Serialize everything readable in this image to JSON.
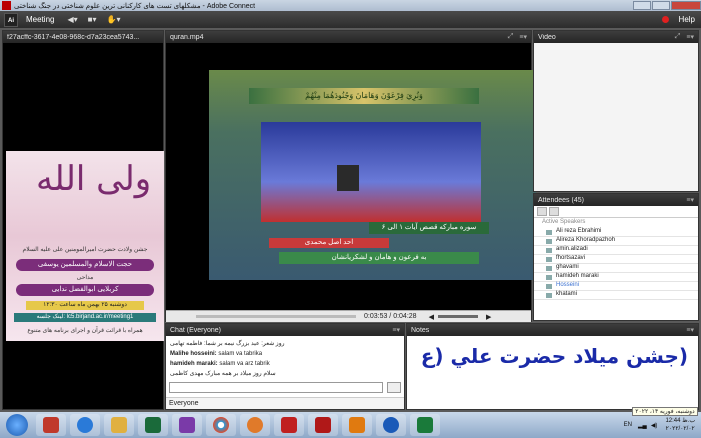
{
  "window": {
    "title": "مشکلهای تست های کارکنانی ترین علوم شناختی در جنگ شناختی - Adobe Connect"
  },
  "menubar": {
    "meeting": "Meeting",
    "help": "Help"
  },
  "pods": {
    "share_title": "f27acffc-3617-4e08-968c-d7a23cea5743...",
    "video_title": "quran.mp4",
    "camera_title": "Video",
    "attendees_title": "Attendees",
    "attendees_count": "(45)",
    "chat_title": "Chat",
    "chat_scope": "(Everyone)",
    "notes_title": "Notes"
  },
  "poster": {
    "big": "ولی الله",
    "line1": "جشن ولادت حضرت امیرالمومنین علی علیه السلام",
    "band1": "حجت الاسلام والمسلمین یوسفی",
    "line2": "مداحی",
    "band2": "کربلایی ابوالفضل ندایی",
    "yellow": "دوشنبه ۲۵ بهمن ماه ساعت ۱۲:۳۰",
    "teal": "لینک جلسه: lc5.birjand.ac.ir/meeting1",
    "foot": "همراه با قرائت قرآن و اجرای برنامه های متنوع"
  },
  "video": {
    "top_caption": "وَنُرِيَ فِرْعَوْنَ وَهَامَانَ وَجُنُودَهُمَا مِنْهُمْ",
    "cap1": "سوره مبارکه قصص آیات ۱ الی ۶",
    "cap2": "احد اصل محمدی",
    "cap3": "به فرعون و هامان و لشکریانشان",
    "time_current": "0:03:53",
    "time_total": "0:04:28"
  },
  "chat": {
    "messages": [
      {
        "user": "",
        "text": "روز شعر: عید بزرگ نیمه بر شما: فاطمه تهامی"
      },
      {
        "user": "Malihe hosseini:",
        "text": "salam va tabrika"
      },
      {
        "user": "hamideh maraki:",
        "text": "salam va arz tabrik"
      },
      {
        "user": "",
        "text": "سلام روز میلاد بر همه مبارک مهدی کاظمی"
      }
    ],
    "footer": "Everyone"
  },
  "notes": {
    "text": "(جشن میلاد حضرت علي (ع"
  },
  "attendees": {
    "group": "Active Speakers",
    "list": [
      "Ali reza Ebrahimi",
      "Alireza Khoradpazhoh",
      "amin.alizadi",
      "fhortsazavi",
      "ghavami",
      "hamideh maraki",
      "Hosseini",
      "khatami"
    ]
  },
  "taskbar": {
    "lang": "EN",
    "time": "12:44 ب.ظ",
    "date": "۲۰۲۲/۰۲/۰۲",
    "tooltip": "دوشنبه، فوریه ۱۴، ۲۰۲۲"
  },
  "colors": {
    "accent": "#1a2aa8",
    "record": "#e02020"
  }
}
